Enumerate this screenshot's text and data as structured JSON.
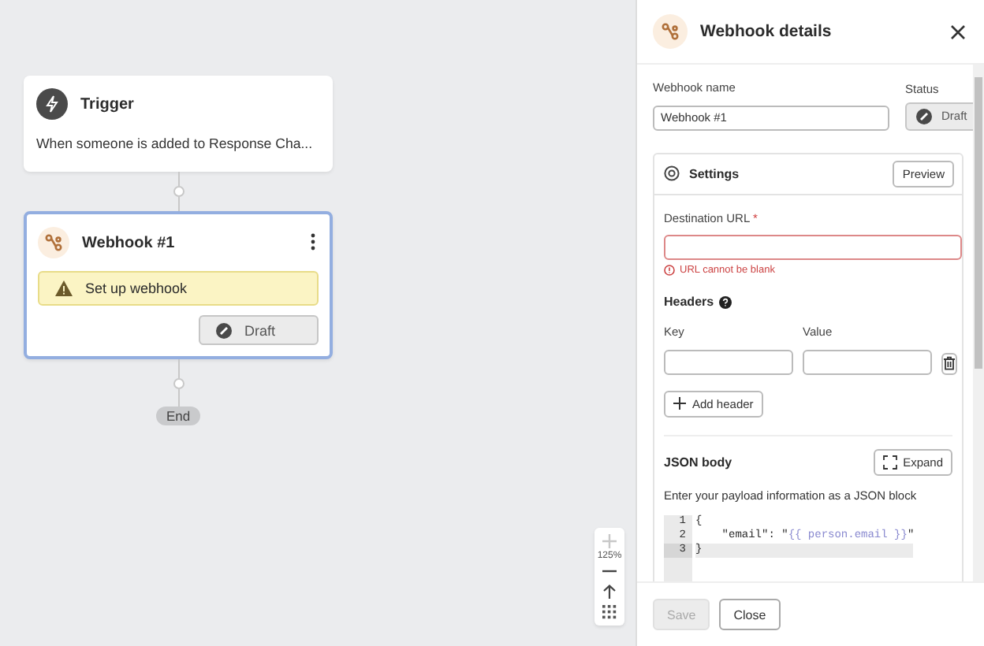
{
  "canvas": {
    "trigger": {
      "title": "Trigger",
      "description": "When someone is added to Response Cha..."
    },
    "step": {
      "title": "Webhook #1",
      "selected": true,
      "warning": "Set up webhook",
      "status": "Draft"
    },
    "end_label": "End",
    "zoom": {
      "level_text": "125%",
      "zoom_in_disabled": true
    }
  },
  "panel": {
    "title": "Webhook details",
    "name_field": {
      "label": "Webhook name",
      "value": "Webhook #1"
    },
    "status": {
      "label": "Status",
      "value": "Draft"
    },
    "settings": {
      "title": "Settings",
      "preview_button": "Preview",
      "destination": {
        "label": "Destination URL",
        "required_mark": "*",
        "error": "URL cannot be blank"
      },
      "headers": {
        "title": "Headers",
        "key_label": "Key",
        "value_label": "Value",
        "add_button": "Add header"
      },
      "json_body": {
        "title": "JSON body",
        "expand_button": "Expand",
        "hint": "Enter your payload information as a JSON block",
        "lines": [
          {
            "number": "1",
            "selected": false,
            "tokens": [
              {
                "kind": "plain",
                "text": "{"
              }
            ]
          },
          {
            "number": "2",
            "selected": false,
            "tokens": [
              {
                "kind": "plain",
                "text": "    \"email\": \""
              },
              {
                "kind": "template",
                "text": "{{ person.email }}"
              },
              {
                "kind": "plain",
                "text": "\""
              }
            ]
          },
          {
            "number": "3",
            "selected": true,
            "tokens": [
              {
                "kind": "plain",
                "text": "}"
              }
            ]
          }
        ]
      }
    },
    "footer": {
      "save_button": {
        "label": "Save",
        "disabled": true
      },
      "close_button": {
        "label": "Close"
      }
    }
  }
}
